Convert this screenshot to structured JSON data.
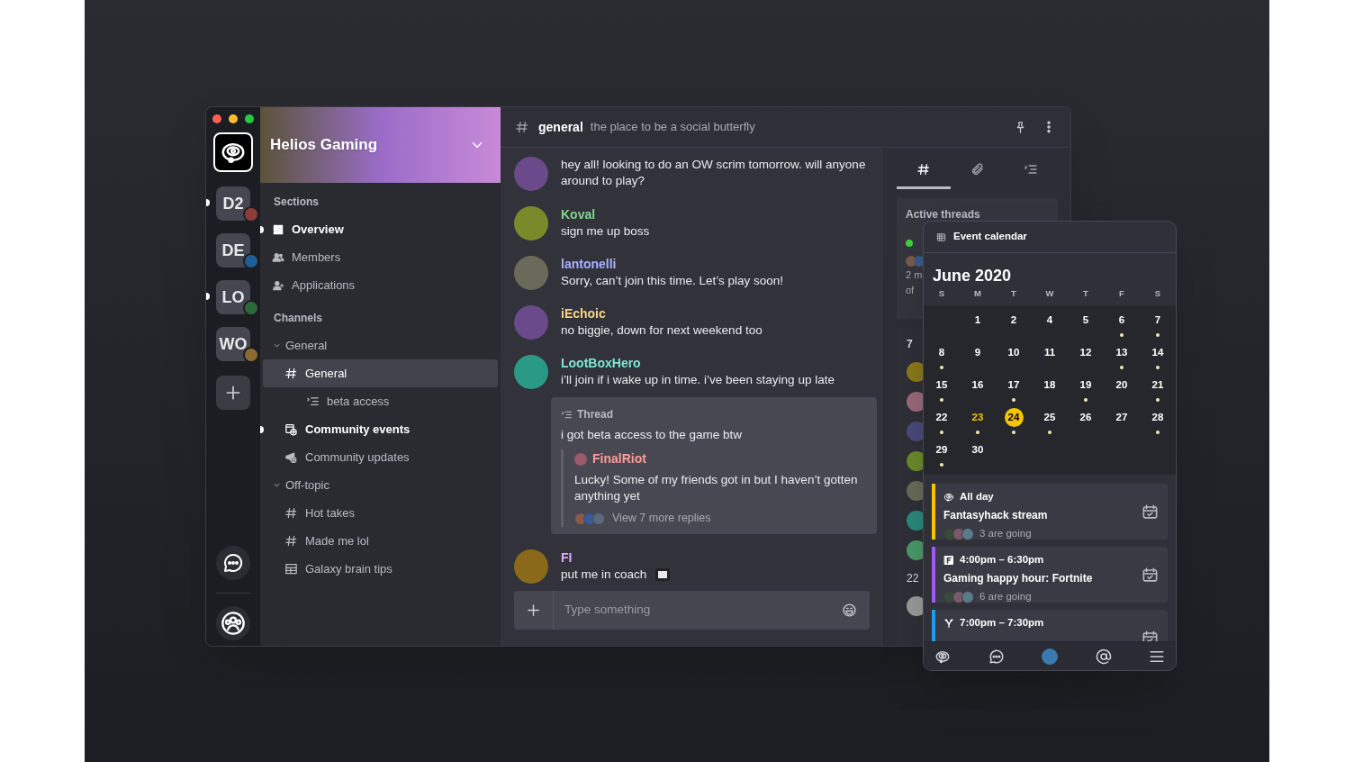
{
  "server_rail": {
    "servers": [
      {
        "label": "D2",
        "unread": true,
        "color": "#8e3b3b"
      },
      {
        "label": "DE",
        "unread": false,
        "color": "#1f5f94"
      },
      {
        "label": "LO",
        "unread": true,
        "color": "#2b6a3a"
      },
      {
        "label": "WO",
        "unread": false,
        "color": "#8a6a2e"
      }
    ]
  },
  "server": {
    "name": "Helios Gaming"
  },
  "sidebar": {
    "sections_heading": "Sections",
    "sections": [
      {
        "label": "Overview",
        "unread": true
      },
      {
        "label": "Members",
        "unread": false
      },
      {
        "label": "Applications",
        "unread": false
      }
    ],
    "channels_heading": "Channels",
    "groups": [
      {
        "label": "General",
        "expanded": true,
        "children": [
          {
            "label": "General",
            "kind": "text",
            "selected": true,
            "unread": false,
            "children": [
              {
                "label": "beta access",
                "kind": "thread",
                "selected": false,
                "unread": false
              }
            ]
          },
          {
            "label": "Community events",
            "kind": "events",
            "selected": false,
            "unread": true
          },
          {
            "label": "Community updates",
            "kind": "announcements",
            "selected": false,
            "unread": false
          }
        ]
      },
      {
        "label": "Off-topic",
        "expanded": true,
        "children": [
          {
            "label": "Hot takes",
            "kind": "text",
            "selected": false,
            "unread": false
          },
          {
            "label": "Made me lol",
            "kind": "text",
            "selected": false,
            "unread": false
          },
          {
            "label": "Galaxy brain tips",
            "kind": "board",
            "selected": false,
            "unread": false
          }
        ]
      }
    ]
  },
  "channel_header": {
    "name": "general",
    "topic": "the place to be a social butterfly"
  },
  "messages": [
    {
      "text": "hey all! looking to do an OW scrim tomorrow. will anyone around to play?"
    },
    {
      "author": "Koval",
      "color": "#7fd88a",
      "text": "sign me up boss"
    },
    {
      "author": "lantonelli",
      "color": "#a9b1ff",
      "text": "Sorry, can’t join this time. Let’s play soon!"
    },
    {
      "author": "iEchoic",
      "color": "#f6d48a",
      "text": "no biggie, down for next weekend too"
    },
    {
      "author": "LootBoxHero",
      "color": "#7fe6d6",
      "text": "i’ll join if i wake up in time. i’ve been staying up late",
      "thread": {
        "label": "Thread",
        "text": "i got beta access to the game btw",
        "reply": {
          "author": "FinalRiot",
          "color": "#ff9b9b",
          "text": "Lucky! Some of my friends got in but I haven’t gotten anything yet"
        },
        "more": "View 7 more replies"
      }
    },
    {
      "author": "FI",
      "color": "#e3a6ff",
      "text": "put me in coach",
      "sticker": true
    }
  ],
  "composer": {
    "placeholder": "Type something"
  },
  "right_panel": {
    "tabs": [
      {
        "kind": "channel",
        "selected": true
      },
      {
        "kind": "attachments",
        "selected": false
      },
      {
        "kind": "threads",
        "selected": false
      }
    ],
    "active_threads": {
      "heading": "Active threads",
      "lines": [
        "2 m",
        "of"
      ]
    },
    "online_heading": "7",
    "offline_heading": "22"
  },
  "calendar": {
    "title": "Event calendar",
    "month": "June 2020",
    "weekdays": [
      "S",
      "M",
      "T",
      "W",
      "T",
      "F",
      "S"
    ],
    "days": [
      {
        "label": "1",
        "events": false,
        "today": false,
        "selected": false
      },
      {
        "label": "2",
        "events": false,
        "today": false,
        "selected": false
      },
      {
        "label": "4",
        "events": false,
        "today": false,
        "selected": false
      },
      {
        "label": "5",
        "events": false,
        "today": false,
        "selected": false
      },
      {
        "label": "6",
        "events": true,
        "today": false,
        "selected": false
      },
      {
        "label": "7",
        "events": true,
        "today": false,
        "selected": false
      },
      {
        "label": "8",
        "events": true,
        "today": false,
        "selected": false
      },
      {
        "label": "9",
        "events": false,
        "today": false,
        "selected": false
      },
      {
        "label": "10",
        "events": false,
        "today": false,
        "selected": false
      },
      {
        "label": "11",
        "events": false,
        "today": false,
        "selected": false
      },
      {
        "label": "12",
        "events": false,
        "today": false,
        "selected": false
      },
      {
        "label": "13",
        "events": true,
        "today": false,
        "selected": false
      },
      {
        "label": "14",
        "events": true,
        "today": false,
        "selected": false
      },
      {
        "label": "15",
        "events": true,
        "today": false,
        "selected": false
      },
      {
        "label": "16",
        "events": false,
        "today": false,
        "selected": false
      },
      {
        "label": "17",
        "events": true,
        "today": false,
        "selected": false
      },
      {
        "label": "18",
        "events": false,
        "today": false,
        "selected": false
      },
      {
        "label": "19",
        "events": true,
        "today": false,
        "selected": false
      },
      {
        "label": "20",
        "events": false,
        "today": false,
        "selected": false
      },
      {
        "label": "21",
        "events": true,
        "today": false,
        "selected": false
      },
      {
        "label": "22",
        "events": true,
        "today": false,
        "selected": false
      },
      {
        "label": "23",
        "events": true,
        "today": true,
        "selected": false
      },
      {
        "label": "24",
        "events": true,
        "today": false,
        "selected": true
      },
      {
        "label": "25",
        "events": true,
        "today": false,
        "selected": false
      },
      {
        "label": "26",
        "events": false,
        "today": false,
        "selected": false
      },
      {
        "label": "27",
        "events": false,
        "today": false,
        "selected": false
      },
      {
        "label": "28",
        "events": true,
        "today": false,
        "selected": false
      },
      {
        "label": "29",
        "events": true,
        "today": false,
        "selected": false
      },
      {
        "label": "30",
        "events": false,
        "today": false,
        "selected": false
      }
    ],
    "events": [
      {
        "time": "All day",
        "title": "Fantasyhack stream",
        "going": "3 are going",
        "color": "#f5c400"
      },
      {
        "time": "4:00pm – 6:30pm",
        "title": "Gaming happy hour: Fortnite",
        "going": "6 are going",
        "color": "#a855f7"
      },
      {
        "time": "7:00pm – 7:30pm",
        "color": "#1d9bf0"
      }
    ],
    "nav": [
      {
        "kind": "home"
      },
      {
        "kind": "chat"
      },
      {
        "kind": "profile"
      },
      {
        "kind": "mentions"
      },
      {
        "kind": "menu"
      }
    ]
  }
}
